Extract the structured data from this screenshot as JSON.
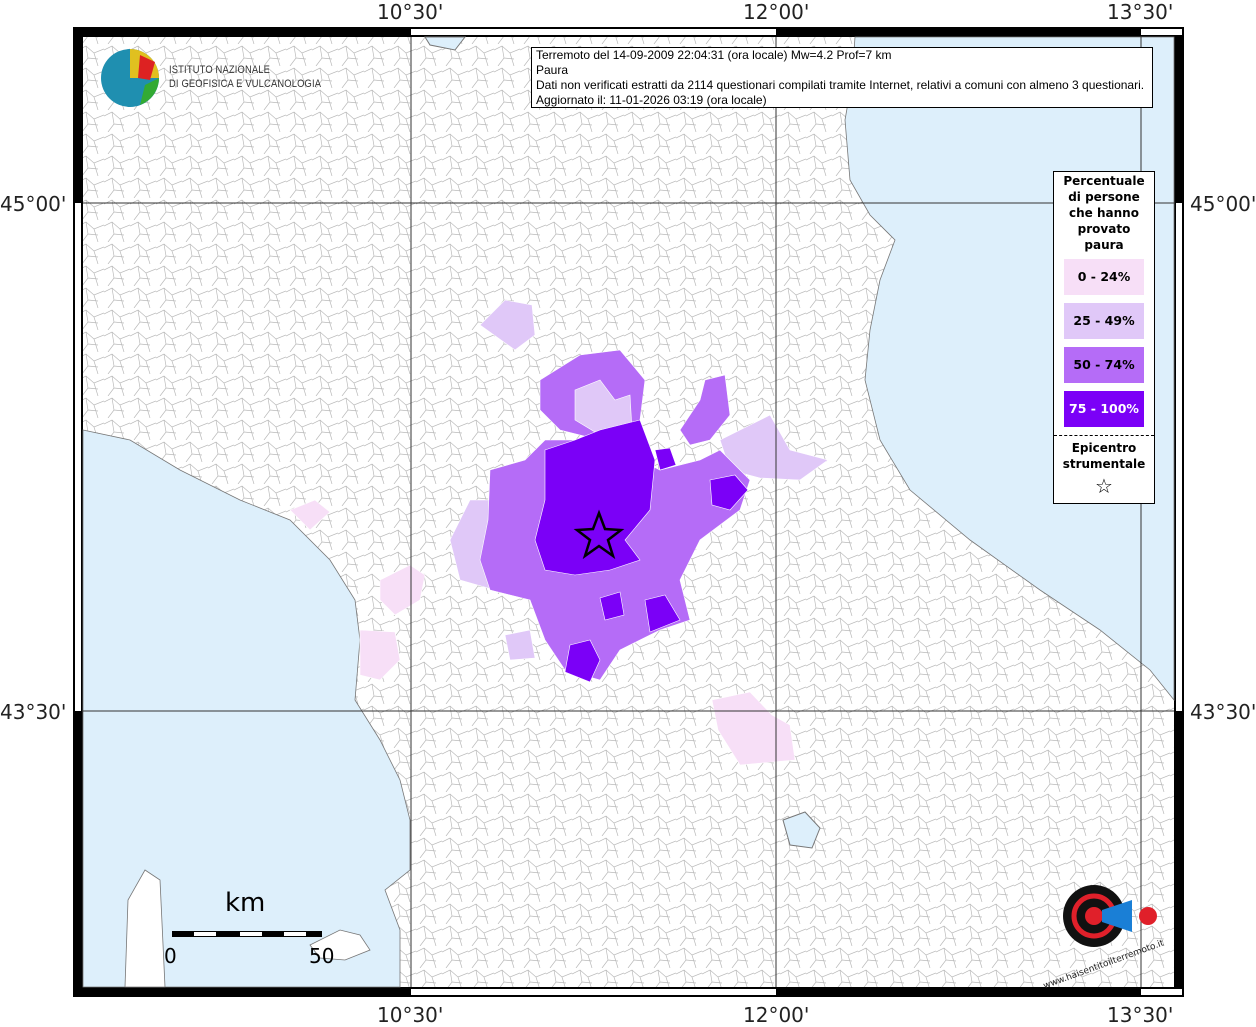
{
  "info": {
    "line1": "Terremoto del 14-09-2009 22:04:31 (ora locale) Mw=4.2 Prof=7 km",
    "line2": "Paura",
    "line3": "Dati non verificati estratti da 2114 questionari compilati tramite Internet, relativi a comuni con almeno 3 questionari.",
    "line4": "Aggiornato il: 11-01-2026 03:19 (ora locale)"
  },
  "logo": {
    "line1": "ISTITUTO NAZIONALE",
    "line2": "DI GEOFISICA E VULCANOLOGIA"
  },
  "watermark": "www.haisentitoilterremoto.it",
  "axes": {
    "lon": [
      "10°30'",
      "12°00'",
      "13°30'"
    ],
    "lat": [
      "45°00'",
      "43°30'"
    ]
  },
  "legend": {
    "title": "Percentuale di persone che hanno provato paura",
    "classes": [
      {
        "label": "0 - 24%",
        "color": "#f7dff7"
      },
      {
        "label": "25 - 49%",
        "color": "#e0c8f8"
      },
      {
        "label": "50 - 74%",
        "color": "#b56cf7"
      },
      {
        "label": "75 - 100%",
        "color": "#7b00f7"
      }
    ],
    "epicenter_label": "Epicentro strumentale",
    "epicenter_symbol": "☆"
  },
  "scale": {
    "unit": "km",
    "start": "0",
    "end": "50"
  },
  "colors": {
    "sea": "#ddeffb",
    "land": "#ffffff",
    "border": "#999999"
  }
}
